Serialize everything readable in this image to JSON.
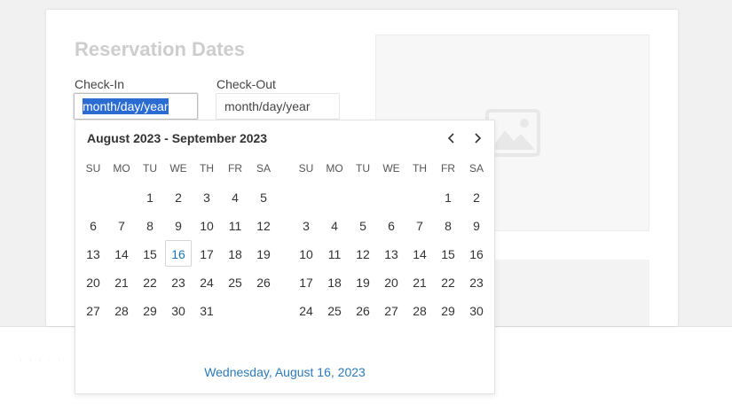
{
  "form": {
    "title": "Reservation Dates",
    "checkin_label": "Check-In",
    "checkout_label": "Check-Out",
    "checkin_value": "month/day/year",
    "checkout_value": "month/day/year"
  },
  "calendar": {
    "header": "August 2023 - September 2023",
    "prev_icon": "chevron-left-icon",
    "next_icon": "chevron-right-icon",
    "weekdays": [
      "SU",
      "MO",
      "TU",
      "WE",
      "TH",
      "FR",
      "SA"
    ],
    "months": [
      {
        "name": "August 2023",
        "weeks": [
          [
            "",
            "",
            "1",
            "2",
            "3",
            "4",
            "5"
          ],
          [
            "6",
            "7",
            "8",
            "9",
            "10",
            "11",
            "12"
          ],
          [
            "13",
            "14",
            "15",
            "16",
            "17",
            "18",
            "19"
          ],
          [
            "20",
            "21",
            "22",
            "23",
            "24",
            "25",
            "26"
          ],
          [
            "27",
            "28",
            "29",
            "30",
            "31",
            "",
            ""
          ]
        ]
      },
      {
        "name": "September 2023",
        "weeks": [
          [
            "",
            "",
            "",
            "",
            "",
            "1",
            "2"
          ],
          [
            "3",
            "4",
            "5",
            "6",
            "7",
            "8",
            "9"
          ],
          [
            "10",
            "11",
            "12",
            "13",
            "14",
            "15",
            "16"
          ],
          [
            "17",
            "18",
            "19",
            "20",
            "21",
            "22",
            "23"
          ],
          [
            "24",
            "25",
            "26",
            "27",
            "28",
            "29",
            "30"
          ]
        ]
      }
    ],
    "today": {
      "month": 0,
      "day": "16"
    },
    "footer": "Wednesday, August 16, 2023"
  },
  "colors": {
    "selection": "#2b6cd2",
    "today_text": "#1a73b8",
    "footer_link": "#2a7ab8",
    "title_gray": "#cdcdcd"
  },
  "icons": {
    "image_placeholder": "image-icon"
  }
}
